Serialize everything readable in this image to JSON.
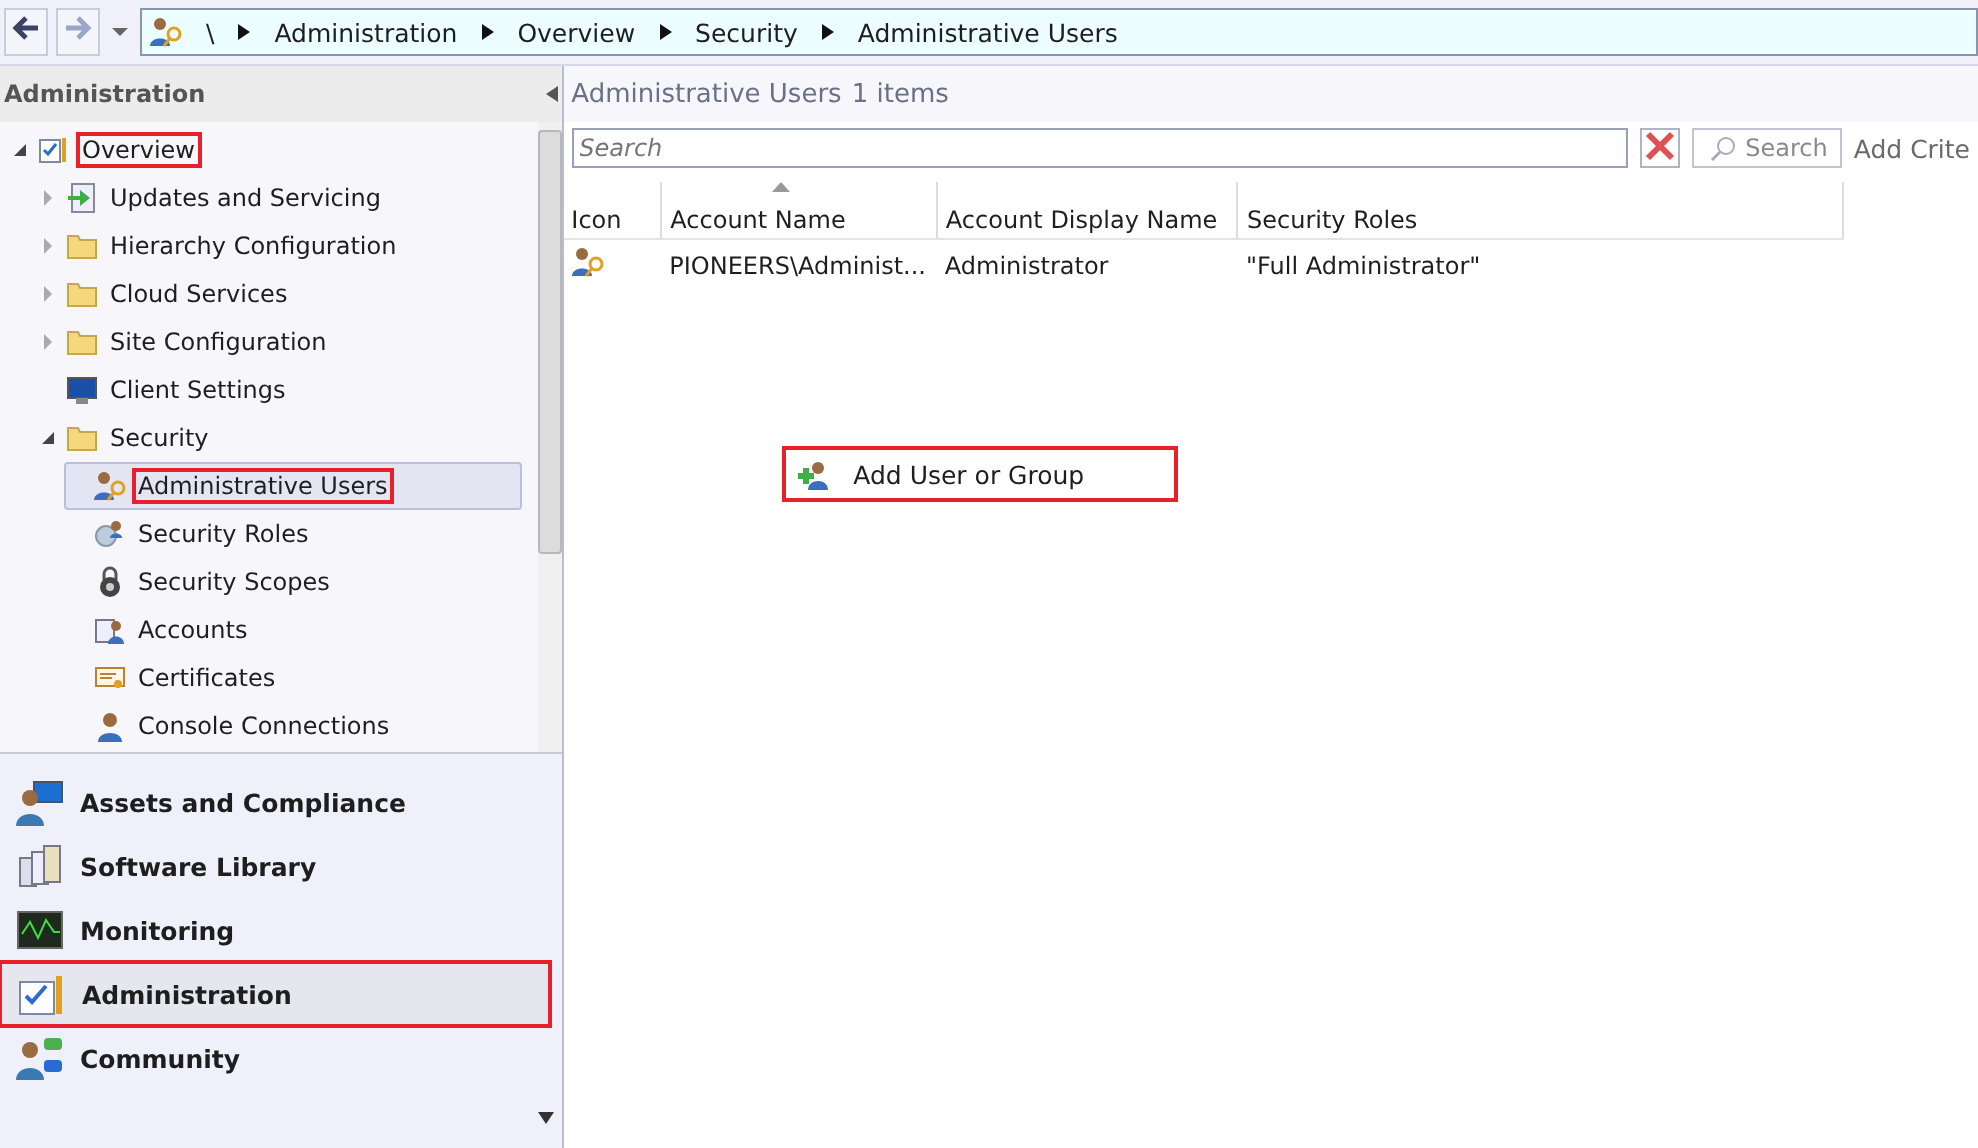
{
  "breadcrumb": {
    "root": "\\",
    "parts": [
      "Administration",
      "Overview",
      "Security",
      "Administrative Users"
    ]
  },
  "navigation": {
    "title": "Administration",
    "tree": [
      {
        "label": "Overview",
        "kind": "overview",
        "expanded": true,
        "annotated": true,
        "selected": false,
        "children": [
          {
            "label": "Updates and Servicing",
            "kind": "updates",
            "expanded": false,
            "annotated": false,
            "selected": false
          },
          {
            "label": "Hierarchy Configuration",
            "kind": "folder",
            "expanded": false,
            "annotated": false,
            "selected": false
          },
          {
            "label": "Cloud Services",
            "kind": "folder",
            "expanded": false,
            "annotated": false,
            "selected": false
          },
          {
            "label": "Site Configuration",
            "kind": "folder",
            "expanded": false,
            "annotated": false,
            "selected": false
          },
          {
            "label": "Client Settings",
            "kind": "monitor",
            "annotated": false,
            "selected": false
          },
          {
            "label": "Security",
            "kind": "folder",
            "expanded": true,
            "annotated": false,
            "selected": false,
            "children": [
              {
                "label": "Administrative Users",
                "kind": "user-key",
                "annotated": true,
                "selected": true
              },
              {
                "label": "Security Roles",
                "kind": "roles",
                "annotated": false,
                "selected": false
              },
              {
                "label": "Security Scopes",
                "kind": "lock",
                "annotated": false,
                "selected": false
              },
              {
                "label": "Accounts",
                "kind": "accounts",
                "annotated": false,
                "selected": false
              },
              {
                "label": "Certificates",
                "kind": "certificate",
                "annotated": false,
                "selected": false
              },
              {
                "label": "Console Connections",
                "kind": "person",
                "annotated": false,
                "selected": false
              }
            ]
          }
        ]
      }
    ]
  },
  "workspaces": [
    {
      "label": "Assets and Compliance",
      "kind": "assets",
      "selected": false,
      "annotated": false
    },
    {
      "label": "Software Library",
      "kind": "library",
      "selected": false,
      "annotated": false
    },
    {
      "label": "Monitoring",
      "kind": "monitoring",
      "selected": false,
      "annotated": false
    },
    {
      "label": "Administration",
      "kind": "administration",
      "selected": true,
      "annotated": true
    },
    {
      "label": "Community",
      "kind": "community",
      "selected": false,
      "annotated": false
    }
  ],
  "content": {
    "title": "Administrative Users",
    "count": "1 items",
    "search": {
      "placeholder": "Search",
      "button": "Search",
      "add_criteria": "Add Crite"
    },
    "table": {
      "columns": [
        "Icon",
        "Account Name",
        "Account Display Name",
        "Security Roles"
      ],
      "rows": [
        {
          "account_name": "PIONEERS\\Administ...",
          "display_name": "Administrator",
          "security_roles": "\"Full Administrator\""
        }
      ]
    },
    "context_menu": {
      "items": [
        {
          "label": "Add User or Group",
          "annotated": true
        }
      ]
    }
  }
}
